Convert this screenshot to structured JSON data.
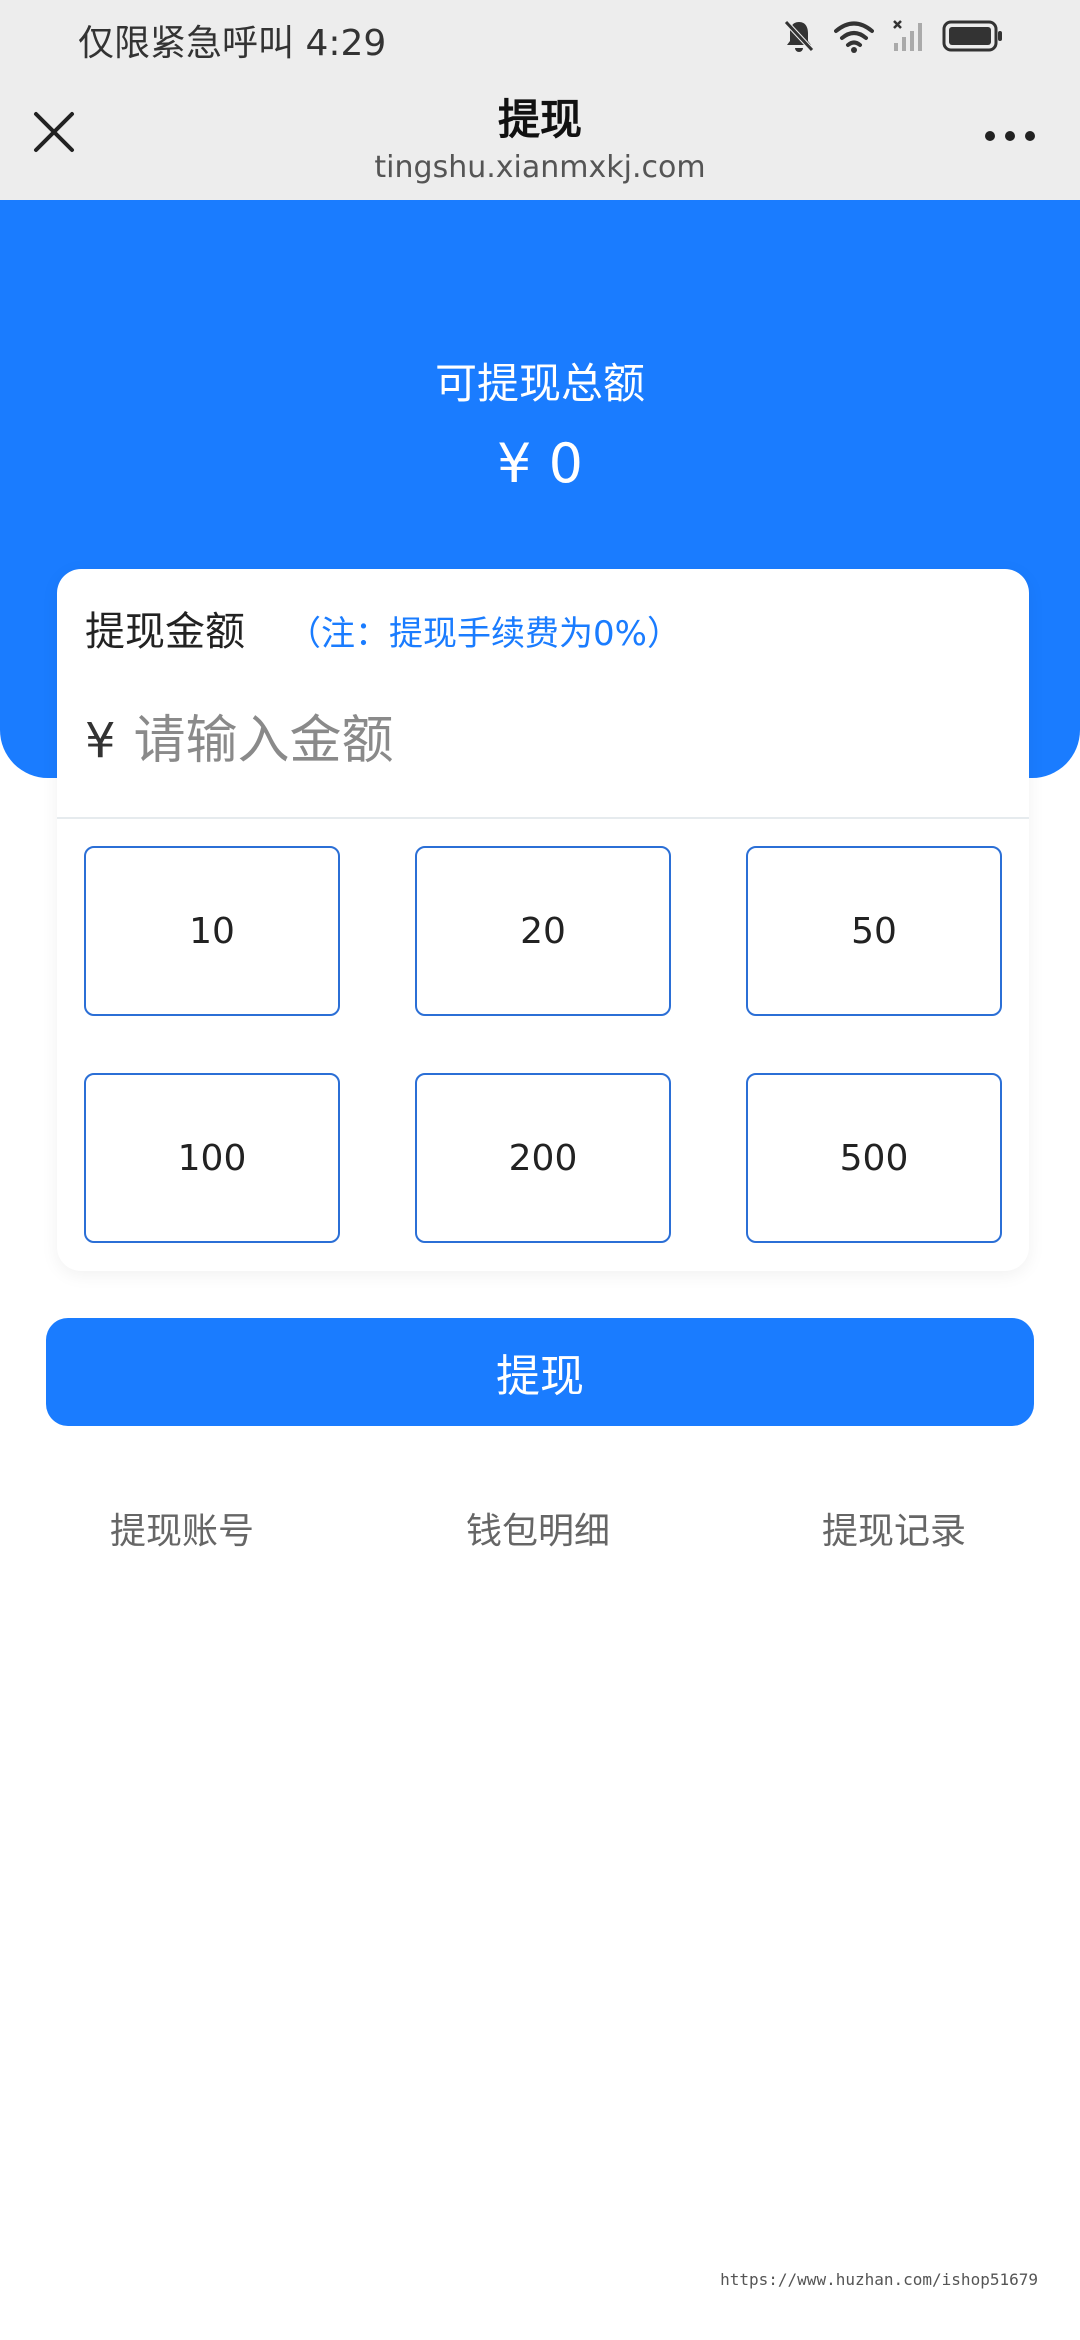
{
  "status_bar": {
    "text": "仅限紧急呼叫 4:29",
    "icons": [
      "bell-muted-icon",
      "wifi-icon",
      "signal-icon",
      "battery-icon"
    ]
  },
  "nav": {
    "title": "提现",
    "url": "tingshu.xianmxkj.com",
    "close_icon": "close-icon",
    "more_icon": "more-icon"
  },
  "hero": {
    "label": "可提现总额",
    "amount": "¥ 0"
  },
  "card": {
    "title": "提现金额",
    "note": "（注：提现手续费为0%）",
    "currency": "¥",
    "placeholder": "请输入金额",
    "presets": [
      "10",
      "20",
      "50",
      "100",
      "200",
      "500"
    ]
  },
  "withdraw_button": "提现",
  "bottom_links": [
    "提现账号",
    "钱包明细",
    "提现记录"
  ],
  "watermark": "https://www.huzhan.com/ishop51679",
  "colors": {
    "primary": "#1a7cff",
    "border": "#2b6fd6",
    "background": "#ededed"
  }
}
